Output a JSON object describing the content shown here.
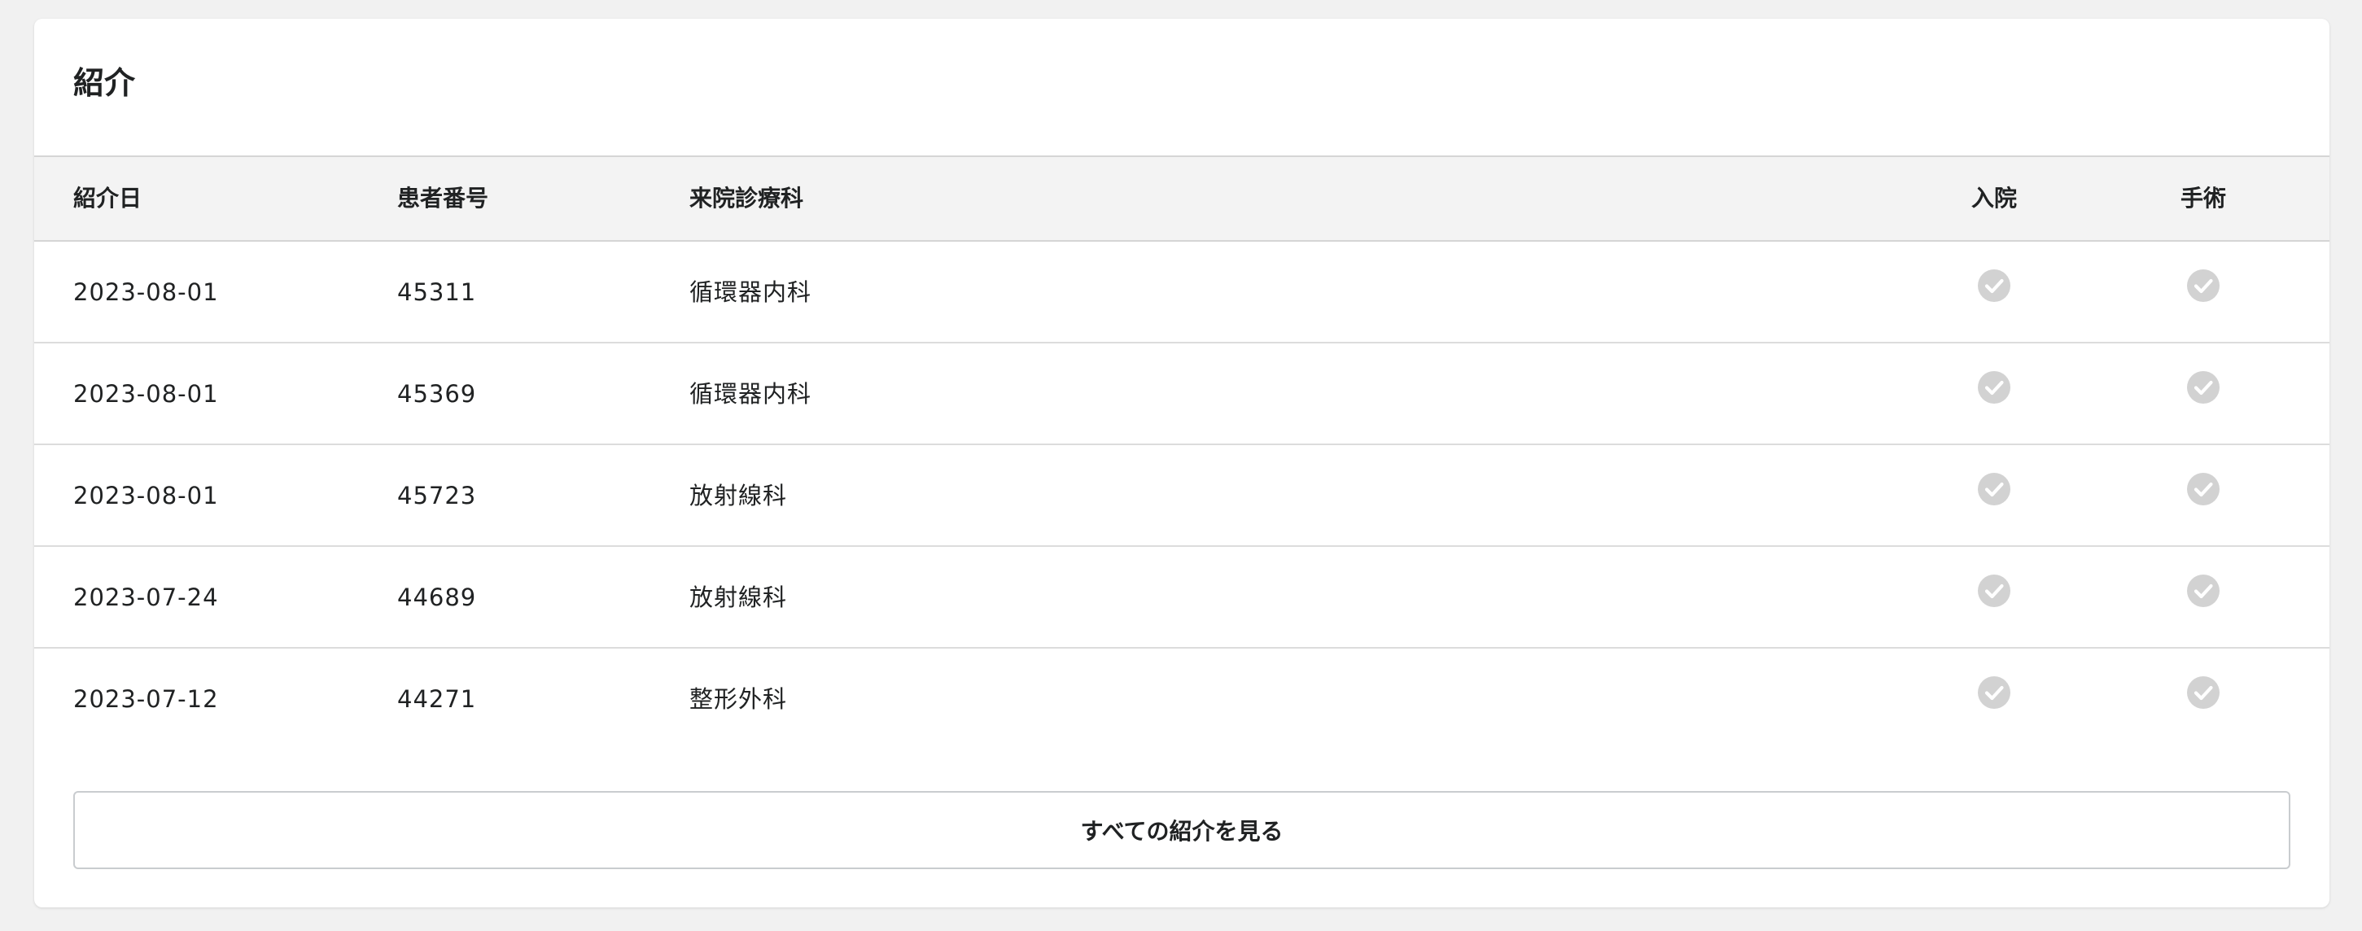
{
  "card": {
    "title": "紹介"
  },
  "table": {
    "headers": {
      "date": "紹介日",
      "patient_id": "患者番号",
      "department": "来院診療科",
      "admission": "入院",
      "surgery": "手術"
    },
    "rows": [
      {
        "date": "2023-08-01",
        "patient_id": "45311",
        "department": "循環器内科",
        "admission": true,
        "surgery": true
      },
      {
        "date": "2023-08-01",
        "patient_id": "45369",
        "department": "循環器内科",
        "admission": true,
        "surgery": true
      },
      {
        "date": "2023-08-01",
        "patient_id": "45723",
        "department": "放射線科",
        "admission": true,
        "surgery": true
      },
      {
        "date": "2023-07-24",
        "patient_id": "44689",
        "department": "放射線科",
        "admission": true,
        "surgery": true
      },
      {
        "date": "2023-07-12",
        "patient_id": "44271",
        "department": "整形外科",
        "admission": true,
        "surgery": true
      }
    ]
  },
  "footer": {
    "view_all_label": "すべての紹介を見る"
  },
  "colors": {
    "check_icon": "#d2d2d2",
    "header_background": "#f3f3f3"
  },
  "icons": {
    "status": "check-circle-icon"
  }
}
